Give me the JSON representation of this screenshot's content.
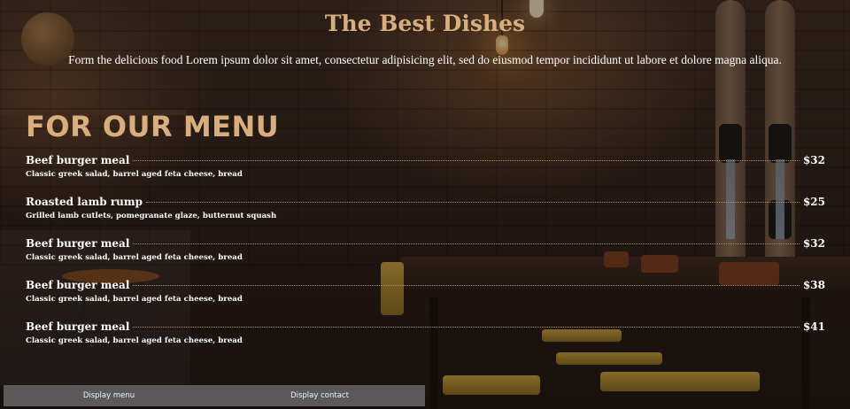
{
  "header": {
    "title": "The Best Dishes",
    "subtitle": "Form the delicious food Lorem ipsum dolor sit amet, consectetur adipisicing elit, sed do eiusmod tempor incididunt ut labore et dolore magna aliqua."
  },
  "menu": {
    "heading": "FOR OUR MENU",
    "items": [
      {
        "name": "Beef burger meal",
        "description": "Classic greek salad, barrel aged feta cheese, bread",
        "price": "$32"
      },
      {
        "name": "Roasted lamb rump",
        "description": "Grilled lamb cutlets, pomegranate glaze, butternut squash",
        "price": "$25"
      },
      {
        "name": "Beef burger meal",
        "description": "Classic greek salad, barrel aged feta cheese, bread",
        "price": "$32"
      },
      {
        "name": "Beef burger meal",
        "description": "Classic greek salad, barrel aged feta cheese, bread",
        "price": "$38"
      },
      {
        "name": "Beef burger meal",
        "description": "Classic greek salad, barrel aged feta cheese, bread",
        "price": "$41"
      }
    ]
  },
  "tabs": {
    "menu_label": "Display menu",
    "contact_label": "Display contact"
  },
  "colors": {
    "accent": "#d8ae7e",
    "text": "#ffffff",
    "tab_background": "#5b5959"
  }
}
